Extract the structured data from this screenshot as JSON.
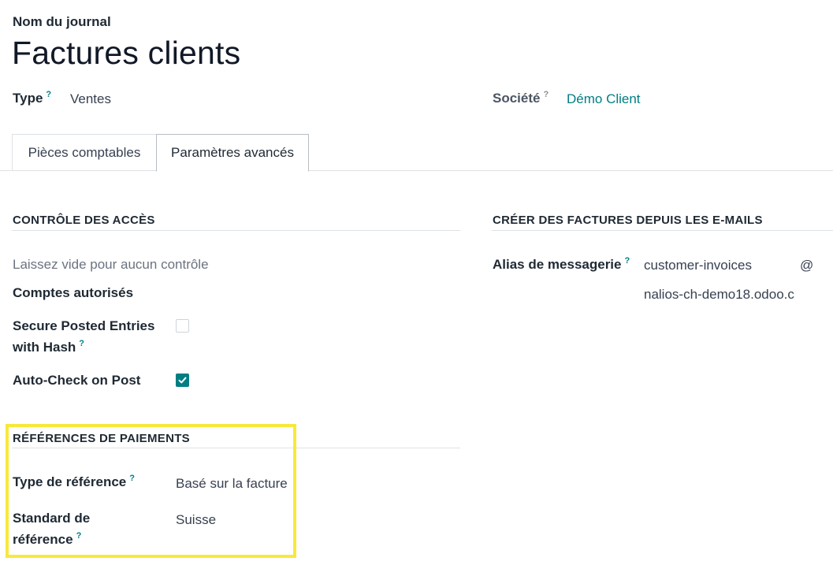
{
  "header": {
    "journal_name_label": "Nom du journal",
    "journal_name": "Factures clients"
  },
  "fields": {
    "type_label": "Type",
    "type_help": "?",
    "type_value": "Ventes",
    "company_label": "Société",
    "company_help": "?",
    "company_value": "Démo Client"
  },
  "tabs": [
    {
      "label": "Pièces comptables",
      "active": false
    },
    {
      "label": "Paramètres avancés",
      "active": true
    }
  ],
  "access_control": {
    "title": "CONTRÔLE DES ACCÈS",
    "placeholder": "Laissez vide pour aucun contrôle",
    "allowed_accounts_label": "Comptes autorisés",
    "secure_hash_label_line1": "Secure Posted Entries",
    "secure_hash_label_line2": "with Hash",
    "secure_hash_help": "?",
    "secure_hash_checked": false,
    "auto_check_label": "Auto-Check on Post",
    "auto_check_checked": true
  },
  "email_invoices": {
    "title": "CRÉER DES FACTURES DEPUIS LES E-MAILS",
    "alias_label": "Alias de messagerie",
    "alias_help": "?",
    "alias_value": "customer-invoices",
    "alias_at": "@",
    "alias_domain": "nalios-ch-demo18.odoo.c"
  },
  "payment_refs": {
    "title": "RÉFÉRENCES DE PAIEMENTS",
    "ref_type_label": "Type de référence",
    "ref_type_help": "?",
    "ref_type_value": "Basé sur la facture",
    "ref_standard_label_line1": "Standard de",
    "ref_standard_label_line2": "référence",
    "ref_standard_help": "?",
    "ref_standard_value": "Suisse"
  },
  "colors": {
    "accent": "#017e84",
    "highlight": "#f7e93a"
  }
}
